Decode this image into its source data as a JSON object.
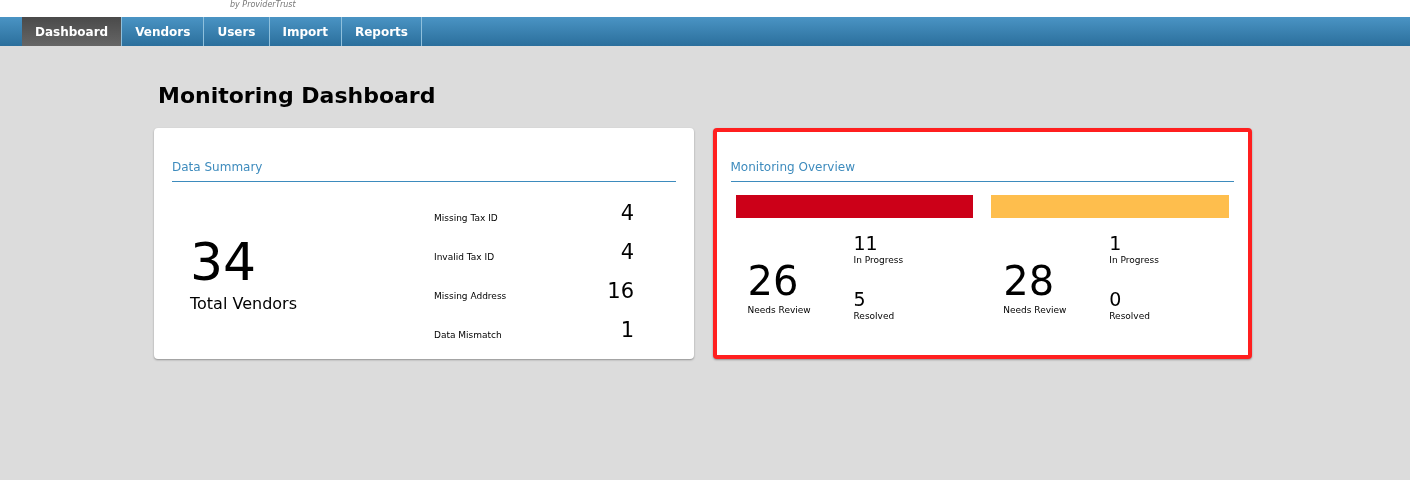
{
  "header": {
    "tagline": "by ProviderTrust"
  },
  "nav": [
    {
      "label": "Dashboard",
      "selected": true
    },
    {
      "label": "Vendors",
      "selected": false
    },
    {
      "label": "Users",
      "selected": false
    },
    {
      "label": "Import",
      "selected": false
    },
    {
      "label": "Reports",
      "selected": false
    }
  ],
  "page_title": "Monitoring Dashboard",
  "data_summary": {
    "title": "Data Summary",
    "highlighted": false,
    "total": "34",
    "total_label": "Total Vendors",
    "items": [
      {
        "label": "Missing Tax ID",
        "value": "4"
      },
      {
        "label": "Invalid Tax ID",
        "value": "4"
      },
      {
        "label": "Missing Address",
        "value": "16"
      },
      {
        "label": "Data Mismatch",
        "value": "1"
      }
    ]
  },
  "monitoring_overview": {
    "title": "Monitoring Overview",
    "highlighted": true,
    "groups": [
      {
        "color": "#cc0018",
        "needs_review": "26",
        "needs_review_label": "Needs Review",
        "in_progress": "11",
        "in_progress_label": "In Progress",
        "resolved": "5",
        "resolved_label": "Resolved"
      },
      {
        "color": "#febe4d",
        "needs_review": "28",
        "needs_review_label": "Needs Review",
        "in_progress": "1",
        "in_progress_label": "In Progress",
        "resolved": "0",
        "resolved_label": "Resolved"
      }
    ]
  }
}
